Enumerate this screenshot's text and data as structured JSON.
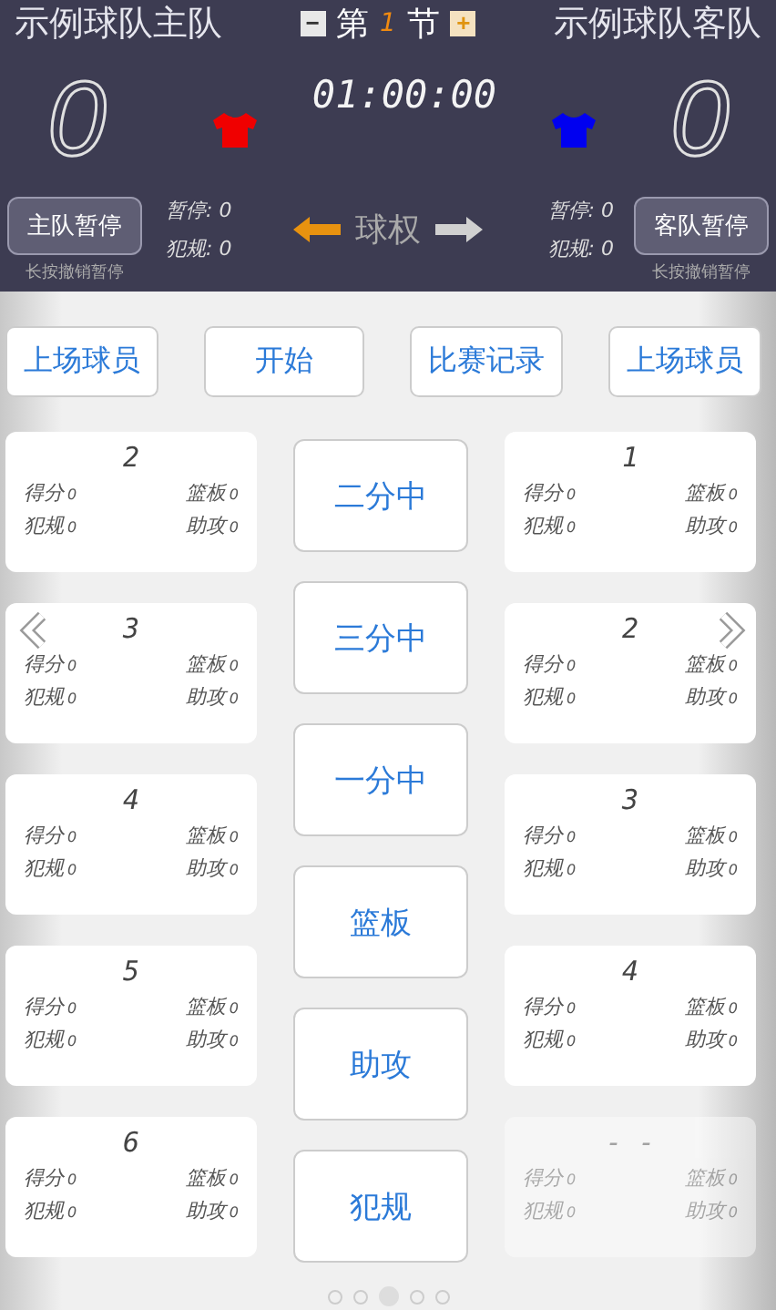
{
  "header": {
    "home_team": "示例球队主队",
    "away_team": "示例球队客队",
    "period_prefix": "第",
    "period": "1",
    "period_suffix": "节",
    "period_minus": "−",
    "period_plus": "+",
    "home_score": "0",
    "away_score": "0",
    "clock": "01:00:00",
    "home_timeout_button": "主队暂停",
    "away_timeout_button": "客队暂停",
    "home_hint": "长按撤销暂停",
    "away_hint": "长按撤销暂停",
    "home_stats": [
      {
        "label": "暂停:",
        "value": "0"
      },
      {
        "label": "犯规:",
        "value": "0"
      }
    ],
    "away_stats": [
      {
        "label": "暂停:",
        "value": "0"
      },
      {
        "label": "犯规:",
        "value": "0"
      }
    ],
    "possession": {
      "label": "球权",
      "arrows": [
        {
          "selected": true
        },
        {
          "selected": false
        }
      ]
    }
  },
  "toolbar": [
    "上场球员",
    "开始",
    "比赛记录",
    "上场球员"
  ],
  "home_players": [
    {
      "number": "2",
      "disabled": false,
      "stats": [
        {
          "label": "得分",
          "value": "0"
        },
        {
          "label": "篮板",
          "value": "0"
        },
        {
          "label": "犯规",
          "value": "0"
        },
        {
          "label": "助攻",
          "value": "0"
        }
      ]
    },
    {
      "number": "3",
      "disabled": false,
      "stats": [
        {
          "label": "得分",
          "value": "0"
        },
        {
          "label": "篮板",
          "value": "0"
        },
        {
          "label": "犯规",
          "value": "0"
        },
        {
          "label": "助攻",
          "value": "0"
        }
      ]
    },
    {
      "number": "4",
      "disabled": false,
      "stats": [
        {
          "label": "得分",
          "value": "0"
        },
        {
          "label": "篮板",
          "value": "0"
        },
        {
          "label": "犯规",
          "value": "0"
        },
        {
          "label": "助攻",
          "value": "0"
        }
      ]
    },
    {
      "number": "5",
      "disabled": false,
      "stats": [
        {
          "label": "得分",
          "value": "0"
        },
        {
          "label": "篮板",
          "value": "0"
        },
        {
          "label": "犯规",
          "value": "0"
        },
        {
          "label": "助攻",
          "value": "0"
        }
      ]
    },
    {
      "number": "6",
      "disabled": false,
      "stats": [
        {
          "label": "得分",
          "value": "0"
        },
        {
          "label": "篮板",
          "value": "0"
        },
        {
          "label": "犯规",
          "value": "0"
        },
        {
          "label": "助攻",
          "value": "0"
        }
      ]
    }
  ],
  "actions": [
    "二分中",
    "三分中",
    "一分中",
    "篮板",
    "助攻",
    "犯规"
  ],
  "away_players": [
    {
      "number": "1",
      "disabled": false,
      "stats": [
        {
          "label": "得分",
          "value": "0"
        },
        {
          "label": "篮板",
          "value": "0"
        },
        {
          "label": "犯规",
          "value": "0"
        },
        {
          "label": "助攻",
          "value": "0"
        }
      ]
    },
    {
      "number": "2",
      "disabled": false,
      "stats": [
        {
          "label": "得分",
          "value": "0"
        },
        {
          "label": "篮板",
          "value": "0"
        },
        {
          "label": "犯规",
          "value": "0"
        },
        {
          "label": "助攻",
          "value": "0"
        }
      ]
    },
    {
      "number": "3",
      "disabled": false,
      "stats": [
        {
          "label": "得分",
          "value": "0"
        },
        {
          "label": "篮板",
          "value": "0"
        },
        {
          "label": "犯规",
          "value": "0"
        },
        {
          "label": "助攻",
          "value": "0"
        }
      ]
    },
    {
      "number": "4",
      "disabled": false,
      "stats": [
        {
          "label": "得分",
          "value": "0"
        },
        {
          "label": "篮板",
          "value": "0"
        },
        {
          "label": "犯规",
          "value": "0"
        },
        {
          "label": "助攻",
          "value": "0"
        }
      ]
    },
    {
      "number": "- -",
      "disabled": true,
      "stats": [
        {
          "label": "得分",
          "value": "0"
        },
        {
          "label": "篮板",
          "value": "0"
        },
        {
          "label": "犯规",
          "value": "0"
        },
        {
          "label": "助攻",
          "value": "0"
        }
      ]
    }
  ],
  "pager": [
    {
      "selected": false
    },
    {
      "selected": false
    },
    {
      "selected": true
    },
    {
      "selected": false
    },
    {
      "selected": false
    }
  ]
}
